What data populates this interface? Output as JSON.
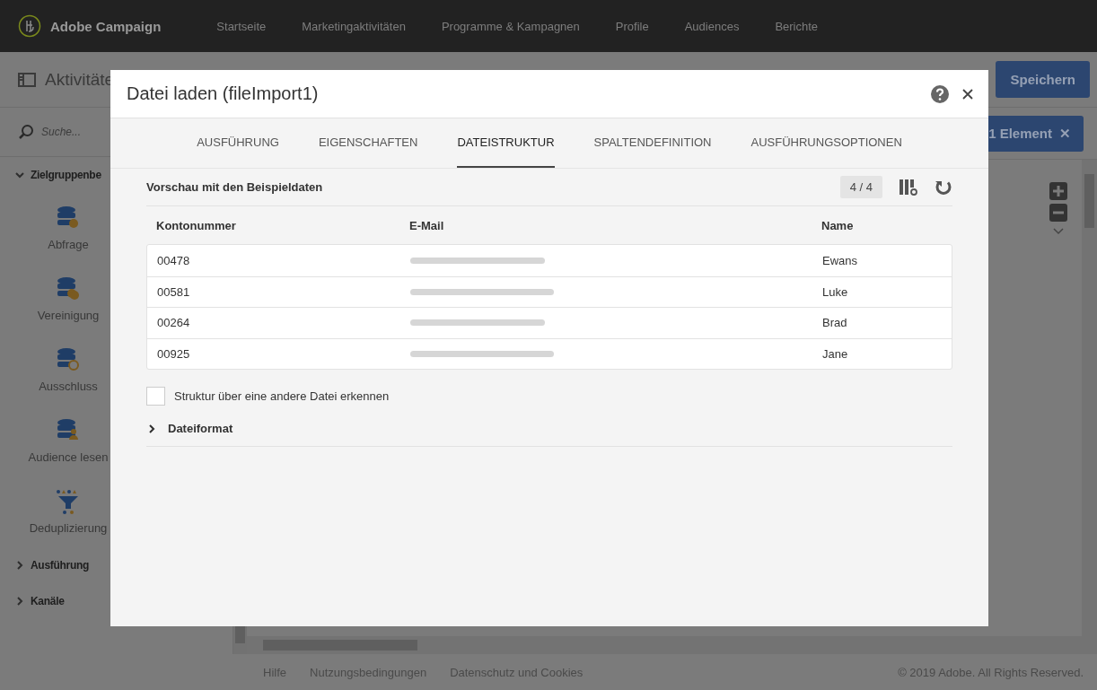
{
  "top_bar": {
    "product": "Adobe Campaign",
    "nav": [
      "Startseite",
      "Marketingaktivitäten",
      "Programme & Kampagnen",
      "Profile",
      "Audiences",
      "Berichte"
    ]
  },
  "app_header": {
    "title": "Aktivitäte",
    "save_button": "Speichern"
  },
  "selection_button": {
    "label": "1 Element",
    "close": "✕"
  },
  "sidebar": {
    "search_placeholder": "Suche...",
    "sections": [
      {
        "label": "Zielgruppenbe",
        "expanded": true,
        "items": [
          {
            "label": "Abfrage",
            "kind": "query"
          },
          {
            "label": "Vereinigung",
            "kind": "union"
          },
          {
            "label": "Ausschluss",
            "kind": "exclusion"
          },
          {
            "label": "Audience lesen",
            "kind": "audience"
          },
          {
            "label": "Deduplizierung",
            "kind": "dedup"
          }
        ]
      },
      {
        "label": "Ausführung",
        "expanded": false
      },
      {
        "label": "Kanäle",
        "expanded": false
      }
    ]
  },
  "footer": {
    "links": [
      "Hilfe",
      "Nutzungsbedingungen",
      "Datenschutz und Cookies"
    ],
    "copyright": "© 2019 Adobe. All Rights Reserved."
  },
  "dialog": {
    "title": "Datei laden (fileImport1)",
    "tabs": [
      {
        "label": "AUSFÜHRUNG",
        "selected": false
      },
      {
        "label": "EIGENSCHAFTEN",
        "selected": false
      },
      {
        "label": "DATEISTRUKTUR",
        "selected": true
      },
      {
        "label": "SPALTENDEFINITION",
        "selected": false
      },
      {
        "label": "AUSFÜHRUNGSOPTIONEN",
        "selected": false
      }
    ],
    "preview": {
      "title": "Vorschau mit den Beispieldaten",
      "count": "4 / 4",
      "columns": [
        "Kontonummer",
        "E-Mail",
        "Name"
      ],
      "rows": [
        {
          "account": "00478",
          "email_redacted": true,
          "name": "Ewans"
        },
        {
          "account": "00581",
          "email_redacted": true,
          "name": "Luke"
        },
        {
          "account": "00264",
          "email_redacted": true,
          "name": "Brad"
        },
        {
          "account": "00925",
          "email_redacted": true,
          "name": "Jane"
        }
      ]
    },
    "detect_checkbox": {
      "label": "Struktur über eine andere Datei erkennen",
      "checked": false
    },
    "file_format": {
      "label": "Dateiformat",
      "expanded": false
    }
  }
}
